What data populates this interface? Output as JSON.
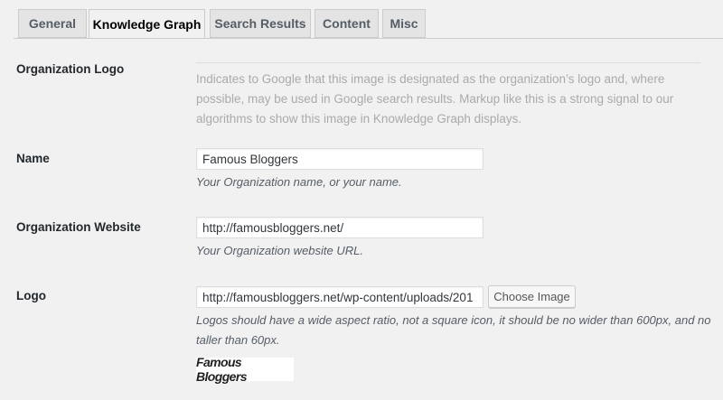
{
  "tabs": [
    {
      "label": "General",
      "active": false
    },
    {
      "label": "Knowledge Graph",
      "active": true
    },
    {
      "label": "Search Results",
      "active": false
    },
    {
      "label": "Content",
      "active": false
    },
    {
      "label": "Misc",
      "active": false
    }
  ],
  "org_logo": {
    "label": "Organization Logo",
    "description": "Indicates to Google that this image is designated as the organization’s logo and, where possible, may be used in Google search results. Markup like this is a strong signal to our algorithms to show this image in Knowledge Graph displays."
  },
  "name": {
    "label": "Name",
    "value": "Famous Bloggers",
    "help": "Your Organization name, or your name."
  },
  "website": {
    "label": "Organization Website",
    "value": "http://famousbloggers.net/",
    "help": "Your Organization website URL."
  },
  "logo": {
    "label": "Logo",
    "value": "http://famousbloggers.net/wp-content/uploads/201",
    "button_label": "Choose Image",
    "help": "Logos should have a wide aspect ratio, not a square icon, it should be no wider than 600px, and no taller than 60px.",
    "preview_text": "Famous Bloggers"
  }
}
